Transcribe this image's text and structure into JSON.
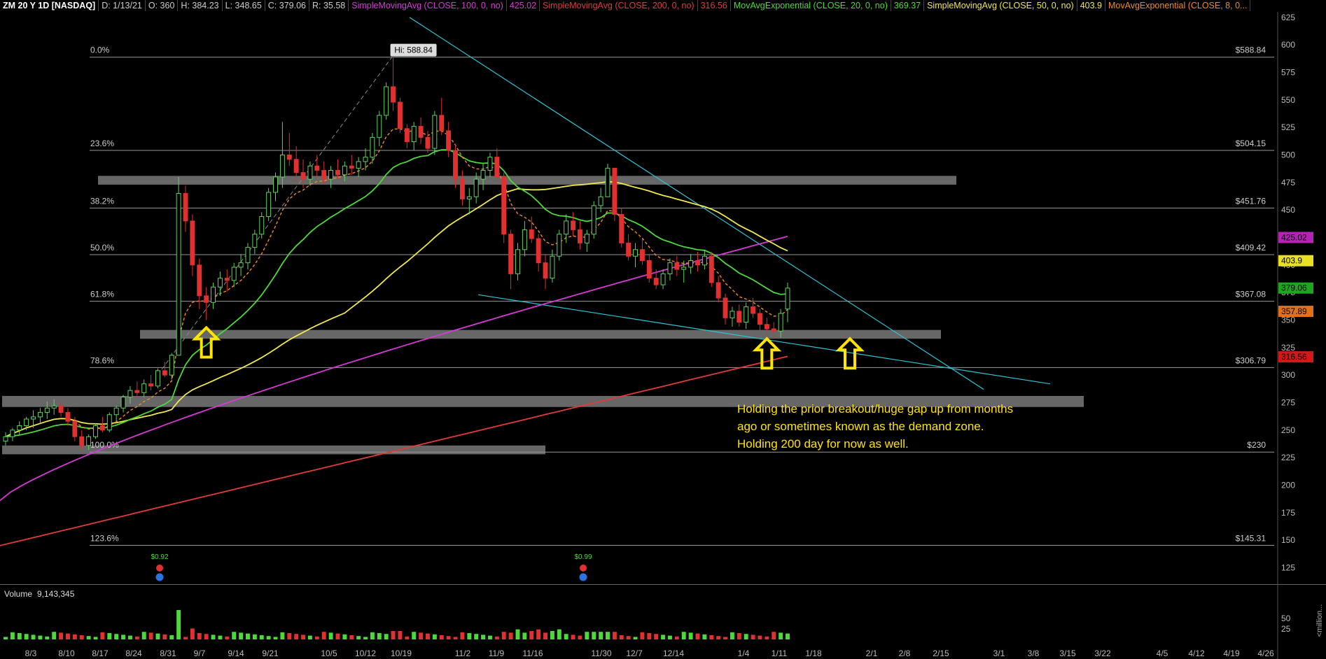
{
  "header": {
    "symbol": "ZM 20 Y 1D [NASDAQ]",
    "date": "D: 1/13/21",
    "open": "O: 360",
    "high": "H: 384.23",
    "low": "L: 348.65",
    "close": "C: 379.06",
    "range": "R: 35.58",
    "studies": [
      {
        "label": "SimpleMovingAvg (CLOSE, 100, 0, no)",
        "value": "425.02",
        "color": "#d63ad6"
      },
      {
        "label": "SimpleMovingAvg (CLOSE, 200, 0, no)",
        "value": "316.56",
        "color": "#e23a3a"
      },
      {
        "label": "MovAvgExponential (CLOSE, 20, 0, no)",
        "value": "369.37",
        "color": "#4cd93a"
      },
      {
        "label": "SimpleMovingAvg (CLOSE, 50, 0, no)",
        "value": "403.9",
        "color": "#f0e84c"
      },
      {
        "label": "MovAvgExponential (CLOSE, 8, 0...",
        "value": "",
        "color": "#f08a2a"
      }
    ]
  },
  "chart_data": {
    "type": "candlestick",
    "ylim": [
      110,
      630
    ],
    "y_ticks": [
      125,
      150,
      175,
      200,
      225,
      250,
      275,
      300,
      325,
      350,
      375,
      400,
      425,
      450,
      475,
      500,
      525,
      550,
      575,
      600,
      625
    ],
    "x_ticks": [
      "8/3",
      "8/10",
      "8/17",
      "8/24",
      "8/31",
      "9/7",
      "9/14",
      "9/21",
      "10/5",
      "10/12",
      "10/19",
      "11/2",
      "11/9",
      "11/16",
      "11/30",
      "12/7",
      "12/14",
      "1/4",
      "1/11",
      "1/18",
      "2/1",
      "2/8",
      "2/15",
      "3/1",
      "3/8",
      "3/15",
      "3/22",
      "4/5",
      "4/12",
      "4/19",
      "4/26"
    ],
    "fib_levels": [
      {
        "label": "0.0%",
        "price_label": "$588.84",
        "value": 588.84
      },
      {
        "label": "23.6%",
        "price_label": "$504.15",
        "value": 504.15
      },
      {
        "label": "38.2%",
        "price_label": "$451.76",
        "value": 451.76
      },
      {
        "label": "50.0%",
        "price_label": "$409.42",
        "value": 409.42
      },
      {
        "label": "61.8%",
        "price_label": "$367.08",
        "value": 367.08
      },
      {
        "label": "78.6%",
        "price_label": "$306.79",
        "value": 306.79
      },
      {
        "label": "100.0%",
        "price_label": "$230",
        "value": 230
      },
      {
        "label": "123.6%",
        "price_label": "$145.31",
        "value": 145.31
      }
    ],
    "high_label": "Hi: 588.84",
    "price_badges": [
      {
        "text": "425.02",
        "value": 425.02,
        "color": "#b523b5"
      },
      {
        "text": "403.9",
        "value": 403.9,
        "color": "#e8e020"
      },
      {
        "text": "379.06",
        "value": 379.06,
        "color": "#1fa51f"
      },
      {
        "text": "357.89",
        "value": 357.89,
        "color": "#e0701a"
      },
      {
        "text": "316.56",
        "value": 316.56,
        "color": "#d01a1a"
      }
    ],
    "zones": [
      {
        "from": 473,
        "to": 481
      },
      {
        "from": 333,
        "to": 341
      },
      {
        "from": 271,
        "to": 281
      },
      {
        "from": 228,
        "to": 236
      }
    ],
    "annotation": [
      "Holding the prior breakout/huge gap up from months",
      "ago or sometimes known as the demand zone.",
      "Holding 200 day for now as well."
    ],
    "dividend_labels": [
      "$0.92",
      "$0.99"
    ],
    "candles": [
      [
        240,
        248,
        236,
        244
      ],
      [
        244,
        252,
        240,
        250
      ],
      [
        250,
        258,
        246,
        254
      ],
      [
        254,
        262,
        250,
        260
      ],
      [
        260,
        268,
        252,
        262
      ],
      [
        262,
        270,
        256,
        266
      ],
      [
        266,
        276,
        260,
        270
      ],
      [
        270,
        278,
        264,
        272
      ],
      [
        272,
        276,
        262,
        266
      ],
      [
        266,
        270,
        254,
        258
      ],
      [
        258,
        262,
        240,
        244
      ],
      [
        244,
        250,
        232,
        236
      ],
      [
        236,
        246,
        232,
        244
      ],
      [
        244,
        256,
        242,
        254
      ],
      [
        254,
        262,
        248,
        250
      ],
      [
        250,
        266,
        248,
        264
      ],
      [
        264,
        272,
        258,
        270
      ],
      [
        270,
        282,
        266,
        280
      ],
      [
        280,
        290,
        274,
        286
      ],
      [
        286,
        294,
        280,
        284
      ],
      [
        284,
        296,
        280,
        292
      ],
      [
        292,
        300,
        286,
        290
      ],
      [
        290,
        306,
        288,
        304
      ],
      [
        304,
        312,
        298,
        300
      ],
      [
        300,
        320,
        296,
        318
      ],
      [
        318,
        480,
        320,
        465
      ],
      [
        465,
        472,
        430,
        440
      ],
      [
        440,
        446,
        390,
        400
      ],
      [
        400,
        406,
        360,
        372
      ],
      [
        372,
        380,
        350,
        366
      ],
      [
        366,
        384,
        360,
        380
      ],
      [
        380,
        394,
        372,
        388
      ],
      [
        388,
        396,
        376,
        386
      ],
      [
        386,
        402,
        380,
        398
      ],
      [
        398,
        410,
        390,
        402
      ],
      [
        402,
        420,
        396,
        416
      ],
      [
        416,
        432,
        410,
        428
      ],
      [
        428,
        448,
        424,
        444
      ],
      [
        444,
        470,
        440,
        466
      ],
      [
        466,
        484,
        458,
        480
      ],
      [
        480,
        530,
        470,
        500
      ],
      [
        500,
        520,
        490,
        496
      ],
      [
        496,
        508,
        476,
        484
      ],
      [
        484,
        496,
        470,
        478
      ],
      [
        478,
        494,
        472,
        490
      ],
      [
        490,
        500,
        480,
        486
      ],
      [
        486,
        494,
        474,
        478
      ],
      [
        478,
        490,
        470,
        486
      ],
      [
        486,
        496,
        478,
        482
      ],
      [
        482,
        494,
        476,
        490
      ],
      [
        490,
        500,
        482,
        488
      ],
      [
        488,
        498,
        480,
        494
      ],
      [
        494,
        506,
        486,
        498
      ],
      [
        498,
        520,
        492,
        516
      ],
      [
        516,
        540,
        508,
        536
      ],
      [
        536,
        566,
        532,
        562
      ],
      [
        562,
        589,
        540,
        548
      ],
      [
        548,
        552,
        520,
        524
      ],
      [
        524,
        528,
        506,
        512
      ],
      [
        512,
        530,
        504,
        526
      ],
      [
        526,
        534,
        510,
        516
      ],
      [
        516,
        522,
        502,
        506
      ],
      [
        506,
        540,
        500,
        536
      ],
      [
        536,
        552,
        518,
        522
      ],
      [
        522,
        530,
        498,
        504
      ],
      [
        504,
        510,
        470,
        478
      ],
      [
        478,
        486,
        454,
        460
      ],
      [
        460,
        470,
        446,
        462
      ],
      [
        462,
        484,
        456,
        478
      ],
      [
        478,
        492,
        468,
        486
      ],
      [
        486,
        502,
        480,
        498
      ],
      [
        498,
        506,
        476,
        480
      ],
      [
        480,
        484,
        420,
        428
      ],
      [
        428,
        432,
        378,
        392
      ],
      [
        392,
        420,
        386,
        414
      ],
      [
        414,
        440,
        408,
        432
      ],
      [
        432,
        444,
        420,
        424
      ],
      [
        424,
        428,
        394,
        402
      ],
      [
        402,
        410,
        378,
        388
      ],
      [
        388,
        414,
        384,
        408
      ],
      [
        408,
        432,
        404,
        428
      ],
      [
        428,
        446,
        420,
        440
      ],
      [
        440,
        448,
        426,
        432
      ],
      [
        432,
        440,
        414,
        420
      ],
      [
        420,
        432,
        412,
        428
      ],
      [
        428,
        458,
        424,
        454
      ],
      [
        454,
        470,
        448,
        462
      ],
      [
        462,
        492,
        470,
        488
      ],
      [
        488,
        484,
        440,
        446
      ],
      [
        446,
        452,
        416,
        420
      ],
      [
        420,
        428,
        404,
        408
      ],
      [
        408,
        420,
        398,
        414
      ],
      [
        414,
        424,
        400,
        404
      ],
      [
        404,
        410,
        384,
        388
      ],
      [
        388,
        396,
        378,
        382
      ],
      [
        382,
        396,
        378,
        392
      ],
      [
        392,
        406,
        386,
        402
      ],
      [
        402,
        408,
        390,
        396
      ],
      [
        396,
        404,
        384,
        398
      ],
      [
        398,
        410,
        392,
        404
      ],
      [
        404,
        412,
        394,
        400
      ],
      [
        400,
        414,
        396,
        408
      ],
      [
        408,
        412,
        380,
        384
      ],
      [
        384,
        390,
        366,
        370
      ],
      [
        370,
        374,
        346,
        352
      ],
      [
        352,
        362,
        344,
        358
      ],
      [
        358,
        364,
        344,
        348
      ],
      [
        348,
        366,
        342,
        362
      ],
      [
        362,
        370,
        352,
        356
      ],
      [
        356,
        360,
        340,
        346
      ],
      [
        346,
        352,
        336,
        342
      ],
      [
        342,
        348,
        334,
        340
      ],
      [
        340,
        360,
        334,
        356
      ],
      [
        360,
        384,
        348,
        379
      ]
    ],
    "volume_label": "Volume",
    "volume_value": "9,143,345",
    "volume_ticks": [
      25,
      50
    ],
    "volume_unit_label": "<million..."
  }
}
